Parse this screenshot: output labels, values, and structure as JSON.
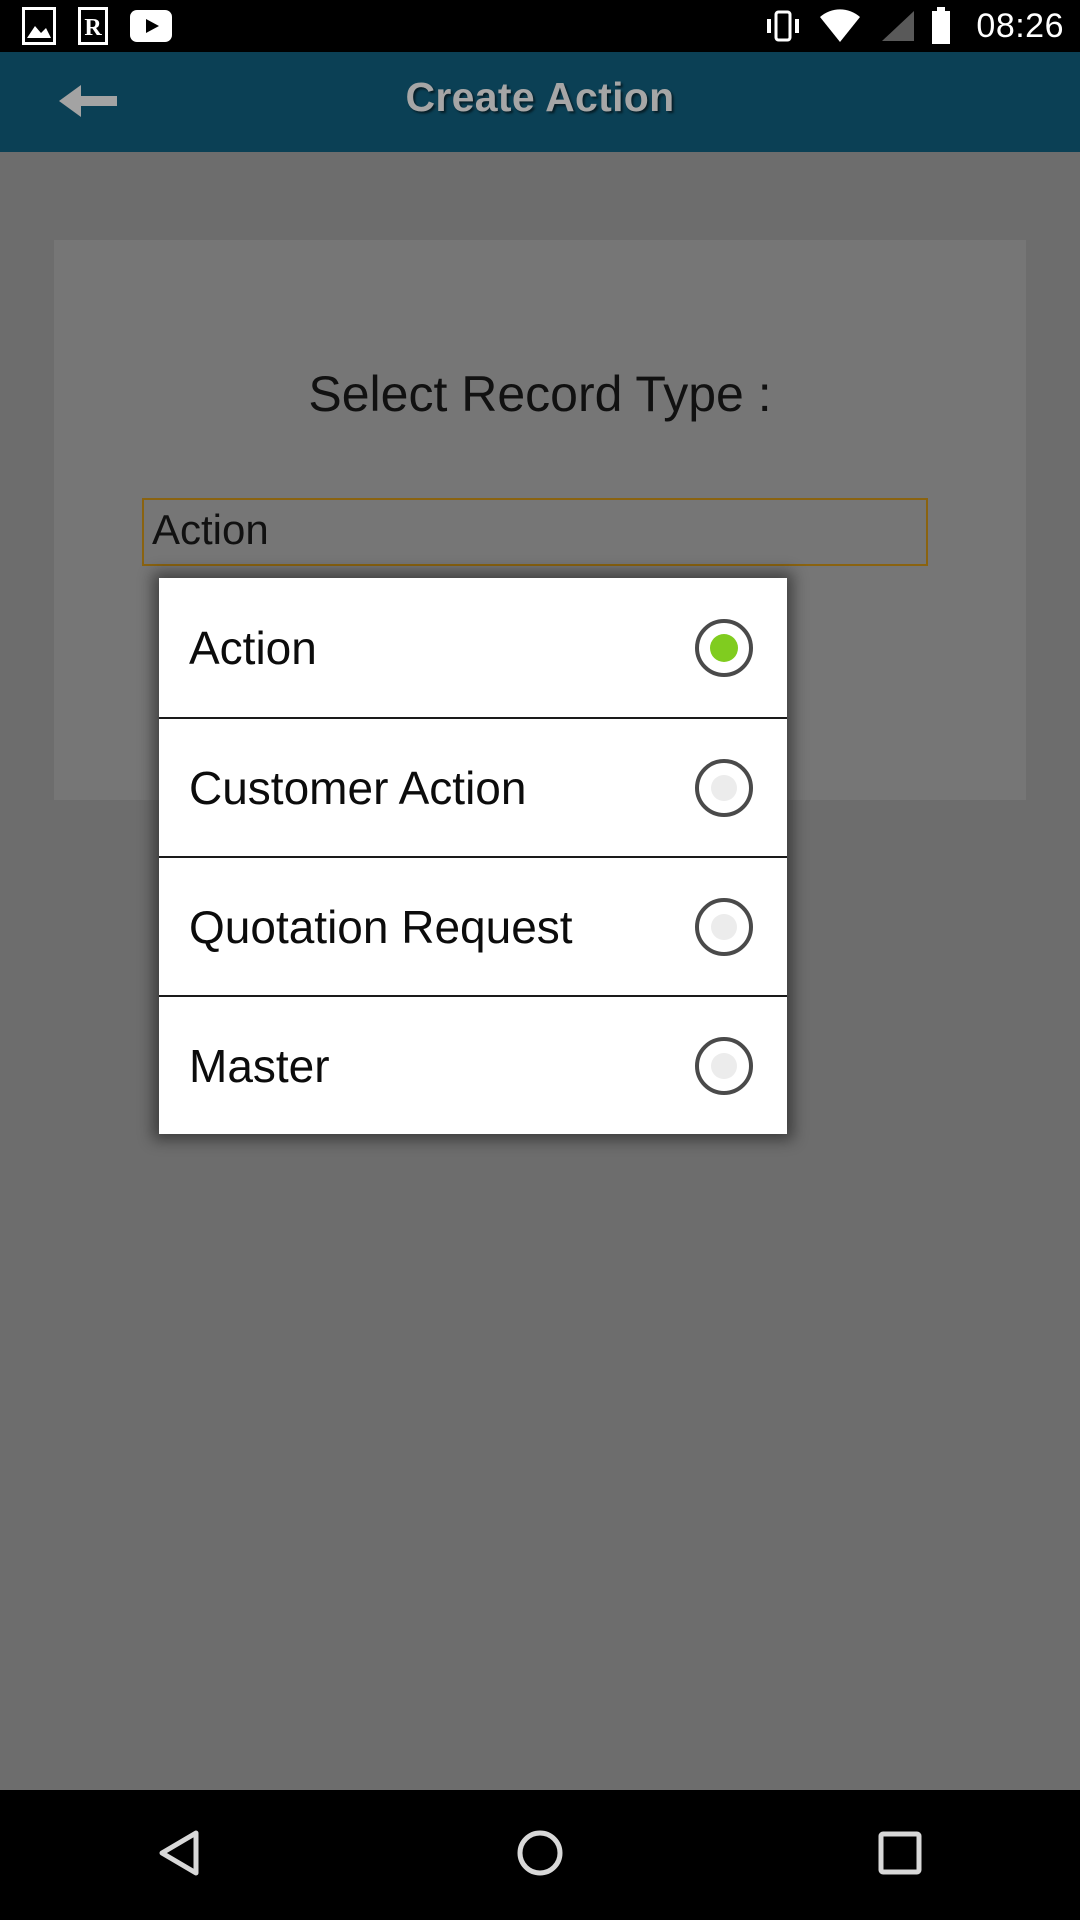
{
  "status_bar": {
    "icons": [
      "image-icon",
      "r-badge-icon",
      "youtube-icon"
    ],
    "right_icons": [
      "vibrate-icon",
      "wifi-icon",
      "signal-icon",
      "battery-icon"
    ],
    "clock": "08:26"
  },
  "app_bar": {
    "title": "Create Action",
    "back_icon": "back-arrow-icon",
    "background_color": "#0b4055",
    "title_color": "#a6a6a6"
  },
  "content": {
    "record_type_label": "Select Record Type :",
    "spinner": {
      "value": "Action",
      "border_color": "#8a6310"
    }
  },
  "dropdown": {
    "items": [
      {
        "label": "Action",
        "selected": true
      },
      {
        "label": "Customer Action",
        "selected": false
      },
      {
        "label": "Quotation Request",
        "selected": false
      },
      {
        "label": "Master",
        "selected": false
      }
    ],
    "selected_color": "#80cc1f",
    "ring_color": "#4a4a4a"
  },
  "nav_bar": {
    "buttons": [
      {
        "name": "back",
        "icon": "triangle-back-icon"
      },
      {
        "name": "home",
        "icon": "circle-home-icon"
      },
      {
        "name": "recents",
        "icon": "square-recents-icon"
      }
    ]
  }
}
